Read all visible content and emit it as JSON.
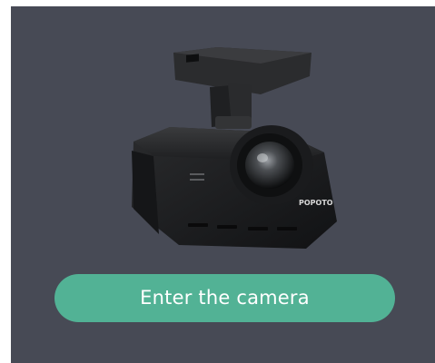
{
  "screen": {
    "background_color": "#474a55",
    "accent_color": "#52b295"
  },
  "product": {
    "icon": "dash-camera-icon",
    "brand": "POPOTO"
  },
  "actions": {
    "enter_label": "Enter the camera"
  }
}
